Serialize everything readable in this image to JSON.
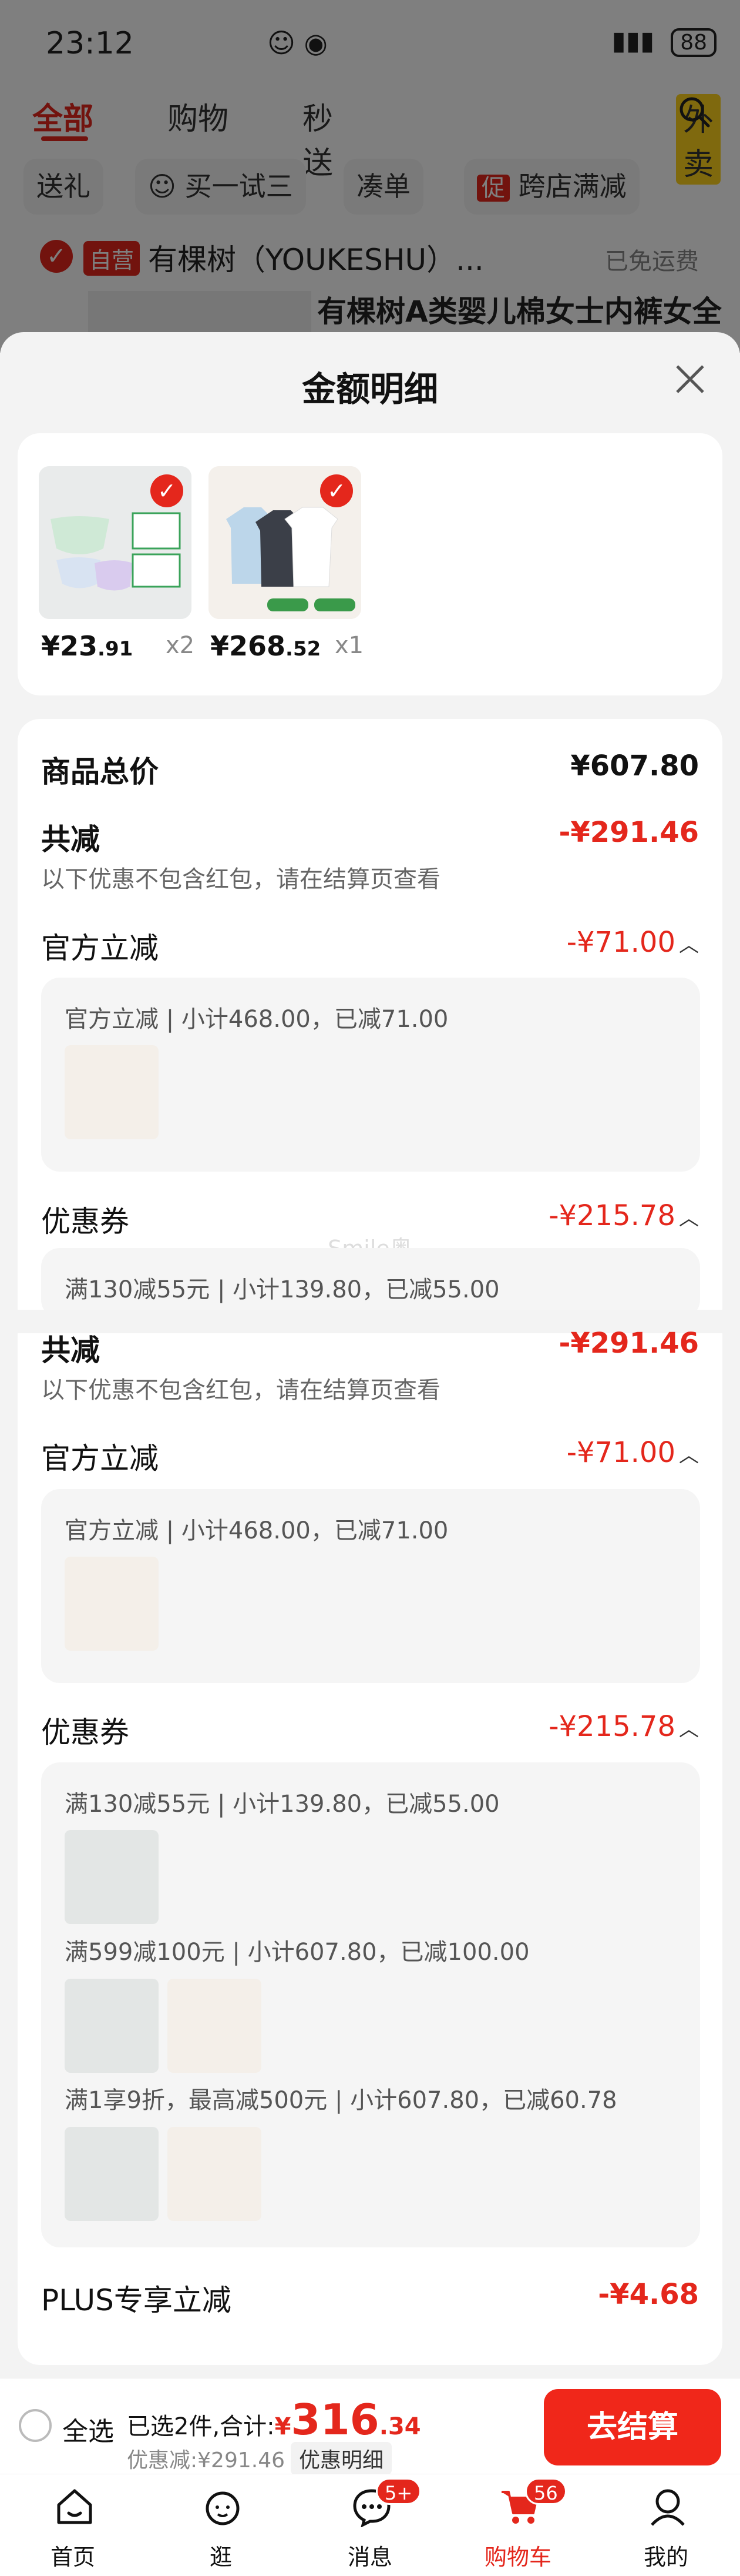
{
  "status_bar": {
    "time": "23:12",
    "battery": "88"
  },
  "top_nav": {
    "all": "全部",
    "purchased": "购物",
    "flash": "秒送",
    "waimai": "外卖"
  },
  "chips": [
    "送礼",
    "买一试三",
    "凑单",
    "跨店满减"
  ],
  "chip_icon_promo": "促",
  "shop": {
    "badge": "自营",
    "name": "有棵树（YOUKESHU）...",
    "shipping": "已免运费"
  },
  "product_title": "有棵树A类婴儿棉女士内裤女全",
  "modal": {
    "title": "金额明细",
    "products": [
      {
        "price_int": "¥23",
        "price_dec": ".91",
        "qty": "x2"
      },
      {
        "price_int": "¥268",
        "price_dec": ".52",
        "qty": "x1"
      }
    ],
    "total_label": "商品总价",
    "total_value": "¥607.80",
    "reduce_label": "共减",
    "reduce_value": "-¥291.46",
    "reduce_note": "以下优惠不包含红包，请在结算页查看",
    "official_label": "官方立减",
    "official_value": "-¥71.00",
    "official_detail": "官方立减 | 小计468.00，已减71.00",
    "coupon_label": "优惠券",
    "coupon_value": "-¥215.78",
    "coupon_detail_1": "满130减55元 | 小计139.80，已减55.00",
    "coupon_detail_2": "满599减100元 | 小计607.80，已减100.00",
    "coupon_detail_3": "满1享9折，最高减500元 | 小计607.80，已减60.78",
    "plus_label": "PLUS专享立减",
    "plus_value": "-¥4.68",
    "watermark": "Smile奥"
  },
  "bottom_bar": {
    "select_all": "全选",
    "selected_prefix": "已选2件,合计:",
    "currency": "¥",
    "total_int": "316",
    "total_dec": ".34",
    "discount_text": "优惠减:¥291.46",
    "detail_chip": "优惠明细",
    "checkout": "去结算"
  },
  "tabs": [
    {
      "label": "首页",
      "badge": ""
    },
    {
      "label": "逛",
      "badge": ""
    },
    {
      "label": "消息",
      "badge": "5+"
    },
    {
      "label": "购物车",
      "badge": "56"
    },
    {
      "label": "我的",
      "badge": ""
    }
  ],
  "colors": {
    "accent": "#e4271c",
    "background": "#f3f3f3"
  }
}
